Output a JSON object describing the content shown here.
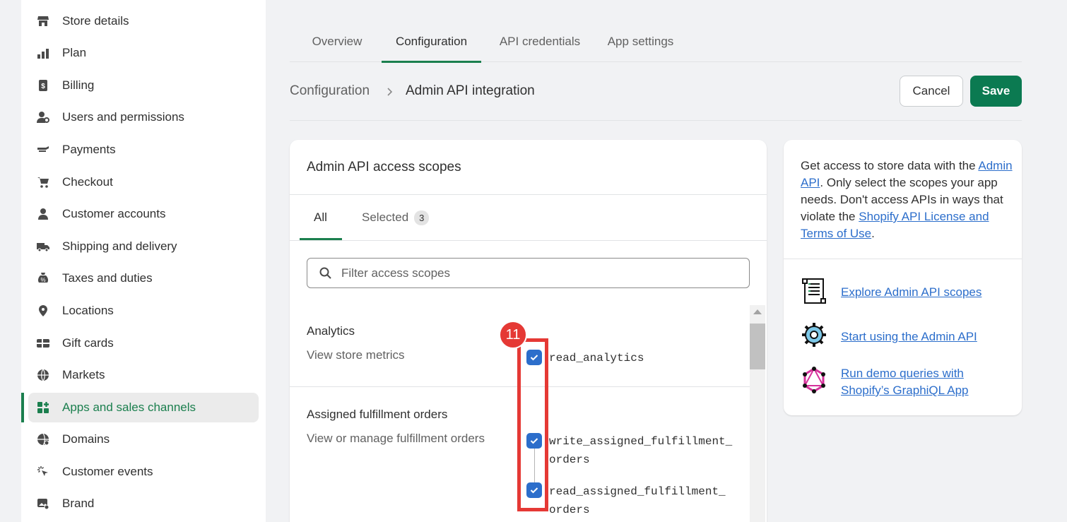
{
  "sidebar": {
    "items": [
      {
        "label": "Store details",
        "icon": "store-icon"
      },
      {
        "label": "Plan",
        "icon": "plan-icon"
      },
      {
        "label": "Billing",
        "icon": "billing-icon"
      },
      {
        "label": "Users and permissions",
        "icon": "users-icon"
      },
      {
        "label": "Payments",
        "icon": "payments-icon"
      },
      {
        "label": "Checkout",
        "icon": "cart-icon"
      },
      {
        "label": "Customer accounts",
        "icon": "person-icon"
      },
      {
        "label": "Shipping and delivery",
        "icon": "truck-icon"
      },
      {
        "label": "Taxes and duties",
        "icon": "taxes-icon"
      },
      {
        "label": "Locations",
        "icon": "location-icon"
      },
      {
        "label": "Gift cards",
        "icon": "gift-card-icon"
      },
      {
        "label": "Markets",
        "icon": "globe-icon"
      },
      {
        "label": "Apps and sales channels",
        "icon": "apps-icon"
      },
      {
        "label": "Domains",
        "icon": "domains-icon"
      },
      {
        "label": "Customer events",
        "icon": "cursor-icon"
      },
      {
        "label": "Brand",
        "icon": "brand-icon"
      }
    ],
    "active_index": 12
  },
  "tabs": [
    "Overview",
    "Configuration",
    "API credentials",
    "App settings"
  ],
  "active_tab": "Configuration",
  "header": {
    "breadcrumb": "Configuration",
    "current": "Admin API integration",
    "cancel_label": "Cancel",
    "save_label": "Save"
  },
  "main_card": {
    "title": "Admin API access scopes",
    "subtabs": {
      "all": "All",
      "selected": "Selected",
      "selected_count": "3"
    },
    "filter_placeholder": "Filter access scopes",
    "groups": [
      {
        "title": "Analytics",
        "desc": "View store metrics",
        "scopes": [
          "read_analytics"
        ]
      },
      {
        "title": "Assigned fulfillment orders",
        "desc": "View or manage fulfillment orders",
        "scopes": [
          "write_assigned_fulfillment_\norders",
          "read_assigned_fulfillment_\norders"
        ]
      }
    ]
  },
  "annotation": {
    "number": "11",
    "color": "#e53935"
  },
  "side_card": {
    "text_before": "Get access to store data with the ",
    "link_admin_api": "Admin API",
    "text_middle": ". Only select the scopes your app needs. Don't access APIs in ways that violate the ",
    "link_license": "Shopify API License and Terms of Use",
    "text_after": ".",
    "links": [
      {
        "label": "Explore Admin API scopes",
        "icon": "scroll-icon"
      },
      {
        "label": "Start using the Admin API",
        "icon": "gear-icon"
      },
      {
        "label": "Run demo queries with Shopify’s GraphiQL App",
        "icon": "graphql-icon"
      }
    ]
  },
  "colors": {
    "accent": "#1b7f4e",
    "save": "#0b7a51",
    "link": "#2c6ecb",
    "checkbox": "#2c6ecb"
  }
}
